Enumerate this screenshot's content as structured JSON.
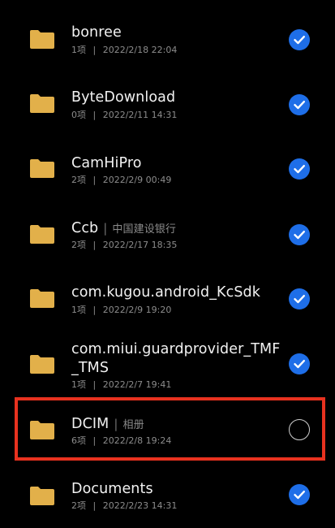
{
  "accent_color": "#1e6ee8",
  "highlight_color": "#e8321f",
  "folder_color": "#e2b04a",
  "files": [
    {
      "name": "bonree",
      "alias": "",
      "count": "1项",
      "date": "2022/2/18 22:04",
      "selected": true
    },
    {
      "name": "ByteDownload",
      "alias": "",
      "count": "0项",
      "date": "2022/2/11 14:31",
      "selected": true
    },
    {
      "name": "CamHiPro",
      "alias": "",
      "count": "2项",
      "date": "2022/2/9 00:49",
      "selected": true
    },
    {
      "name": "Ccb",
      "alias": "中国建设银行",
      "count": "2项",
      "date": "2022/2/17 18:35",
      "selected": true
    },
    {
      "name": "com.kugou.android_KcSdk",
      "alias": "",
      "count": "1项",
      "date": "2022/2/9 19:20",
      "selected": true
    },
    {
      "name_line1": "com.miui.guardprovider_TMF",
      "name_line2": "_TMS",
      "alias": "",
      "count": "1项",
      "date": "2022/2/7 19:41",
      "selected": true
    },
    {
      "name": "DCIM",
      "alias": "相册",
      "count": "6项",
      "date": "2022/2/8 19:24",
      "selected": false
    },
    {
      "name": "Documents",
      "alias": "",
      "count": "2项",
      "date": "2022/2/23 14:31",
      "selected": true
    }
  ],
  "meta_separator": "|",
  "alias_separator": "|",
  "icons": {
    "folder": "folder-icon",
    "check": "checkmark-icon",
    "empty": "empty-circle-icon"
  }
}
